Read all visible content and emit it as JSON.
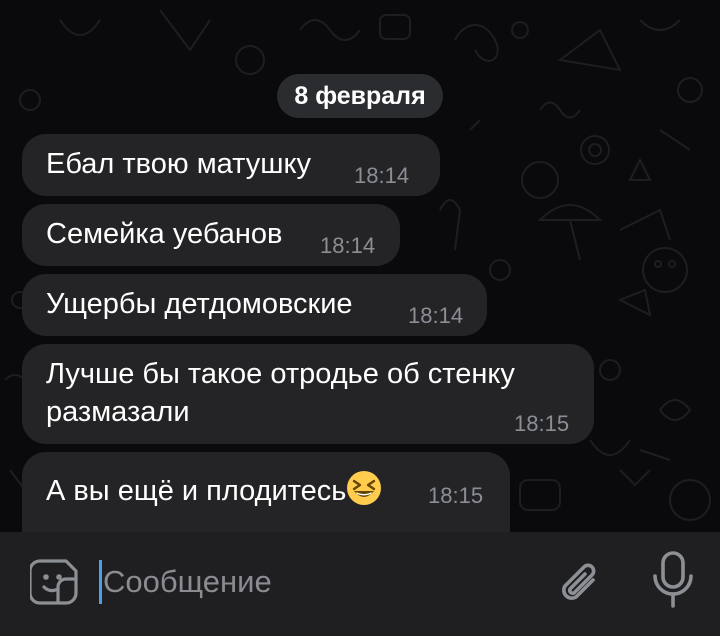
{
  "chat": {
    "date_divider": "8 февраля",
    "messages": [
      {
        "text": "Ебал твою матушку",
        "time": "18:14"
      },
      {
        "text": "Семейка уебанов",
        "time": "18:14"
      },
      {
        "text": "Ущербы детдомовские",
        "time": "18:14"
      },
      {
        "text_line1": "Лучше бы такое отродье об стенку",
        "text_line2": "размазали",
        "time": "18:15"
      },
      {
        "text": "А вы ещё и плодитесь",
        "emoji": "grinning-squinting-face",
        "time": "18:15"
      }
    ]
  },
  "composer": {
    "placeholder": "Сообщение",
    "icons": {
      "left": "sticker-icon",
      "attach": "paperclip-icon",
      "voice": "microphone-icon"
    }
  },
  "colors": {
    "background": "#0b0b0d",
    "bubble": "#242427",
    "date_chip": "#2b2c30",
    "input_bar": "#1f1f22",
    "cursor": "#4d9fe8",
    "time_text": "#8b8e95"
  }
}
